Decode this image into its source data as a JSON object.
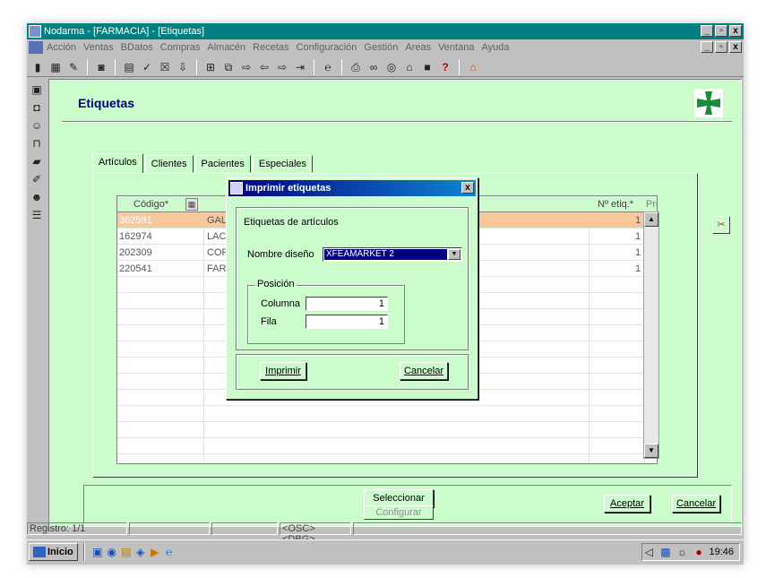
{
  "app": {
    "title": "Nodarma - [FARMACIA] - [Etiquetas]",
    "window_buttons": [
      "_",
      "Š",
      "x"
    ]
  },
  "menu": [
    "Acción",
    "Ventas",
    "BDatos",
    "Compras",
    "Almacén",
    "Recetas",
    "Configuración",
    "Gestión",
    "Areas",
    "Ventana",
    "Ayuda"
  ],
  "toolbar_icons": [
    "report-icon",
    "grid-icon",
    "edit-icon",
    "stop-icon",
    "print-icon",
    "check-icon",
    "delete-icon",
    "export-icon",
    "first-icon",
    "prev-icon",
    "new-icon",
    "back-icon",
    "forward-icon",
    "exit-icon",
    "browser-icon",
    "printer-icon",
    "binoculars-icon",
    "search-icon",
    "calc-icon",
    "stop-square-icon",
    "help-icon",
    "home-icon"
  ],
  "left_icons": [
    "cash-icon",
    "disk-icon",
    "user-icon",
    "cart-icon",
    "truck-icon",
    "pen-icon",
    "users-icon",
    "stack-icon"
  ],
  "page": {
    "title": "Etiquetas",
    "tabs": [
      "Artículos",
      "Clientes",
      "Pacientes",
      "Especiales"
    ]
  },
  "grid": {
    "col_code": "Código*",
    "col_qty": "Nº etiq.*",
    "col_prep": "Prep",
    "rows": [
      {
        "code": "362591",
        "name": "GAL",
        "qty": "1",
        "prep": true
      },
      {
        "code": "162974",
        "name": "LAC",
        "qty": "1",
        "prep": true
      },
      {
        "code": "202309",
        "name": "COF",
        "qty": "1",
        "prep": true
      },
      {
        "code": "220541",
        "name": "FAR",
        "qty": "1",
        "prep": true
      }
    ]
  },
  "buttons": {
    "select": "Seleccionar",
    "configure": "Configurar",
    "accept": "Aceptar",
    "cancel": "Cancelar"
  },
  "dialog": {
    "title": "Imprimir etiquetas",
    "section": "Etiquetas de artículos",
    "design_label": "Nombre diseño",
    "design_value": "XFEAMARKET 2",
    "position_legend": "Posición",
    "column_label": "Columna",
    "column_value": "1",
    "row_label": "Fila",
    "row_value": "1",
    "print": "Imprimir",
    "cancel": "Cancelar"
  },
  "status": {
    "record": "Registro: 1/1",
    "flags": "<OSC> <DBG>"
  },
  "taskbar": {
    "start": "Inicio",
    "time": "19:46"
  },
  "colors": {
    "client_bg": "#ccfbcc",
    "selected_row": "#f7c89a",
    "title_bar": "#008080",
    "dialog_title": "#000080",
    "logo_green": "#1a8c3a"
  }
}
